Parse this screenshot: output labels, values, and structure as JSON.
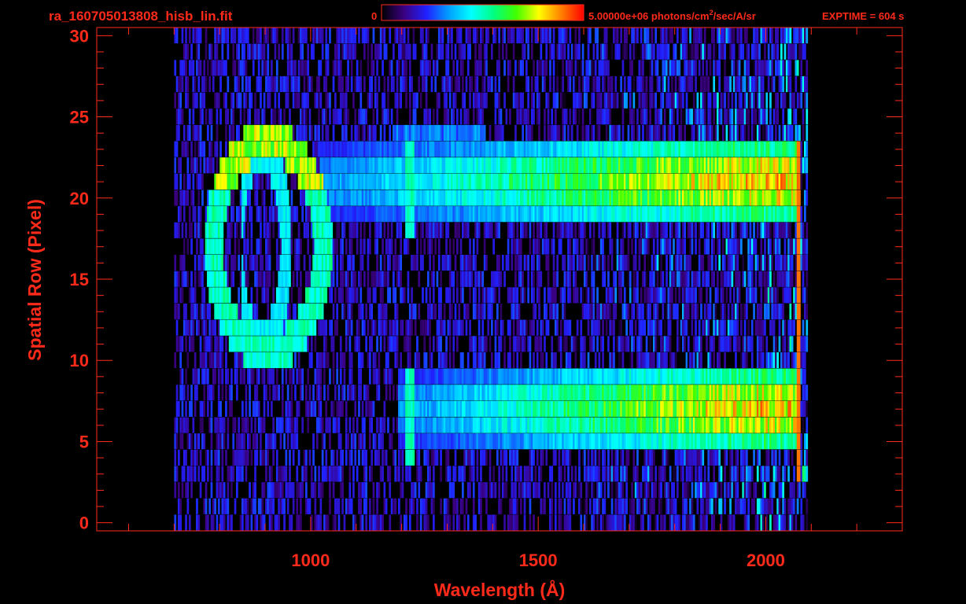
{
  "header": {
    "filename": "ra_160705013808_hisb_lin.fit",
    "colorbar_min": "0",
    "colorbar_max_pre": "5.00000e+06 photons/cm",
    "colorbar_max_sup": "2",
    "colorbar_max_post": "/sec/A/sr",
    "exptime": "EXPTIME = 604 s"
  },
  "colors": {
    "text": "#ff2a1a",
    "axes": "#ff2a1a",
    "background": "#000000",
    "colormap": [
      "#000000",
      "#3a0080",
      "#2020ff",
      "#00a0ff",
      "#00ffff",
      "#00ff80",
      "#40ff00",
      "#ffff00",
      "#ff8000",
      "#ff0000"
    ]
  },
  "chart_data": {
    "type": "heatmap",
    "title": "",
    "xlabel": "Wavelength (Å)",
    "ylabel": "Spatial Row (Pixel)",
    "xlim": [
      530,
      2300
    ],
    "ylim": [
      -0.5,
      30.5
    ],
    "xticks": [
      1000,
      1500,
      2000
    ],
    "yticks": [
      0,
      5,
      10,
      15,
      20,
      25,
      30
    ],
    "xminor_step": 100,
    "yminor_step": 1,
    "data_extent_x": [
      700,
      2090
    ],
    "data_rows": 31,
    "colorbar_range": [
      0,
      5000000
    ],
    "features": {
      "spectral_bands": [
        {
          "row_from": 19,
          "row_to": 23,
          "x_from": 1020,
          "x_to": 2075
        },
        {
          "row_from": 5,
          "row_to": 9,
          "x_from": 1190,
          "x_to": 2075
        }
      ],
      "ring": {
        "x_center": 905,
        "row_center": 17,
        "x_radius": 120,
        "row_radius": 6.5
      },
      "emission_line_x": 1216,
      "faint_line_row_24": {
        "x_from": 1180,
        "x_to": 1380,
        "row": 24
      },
      "red_edge_x": 2070
    }
  }
}
